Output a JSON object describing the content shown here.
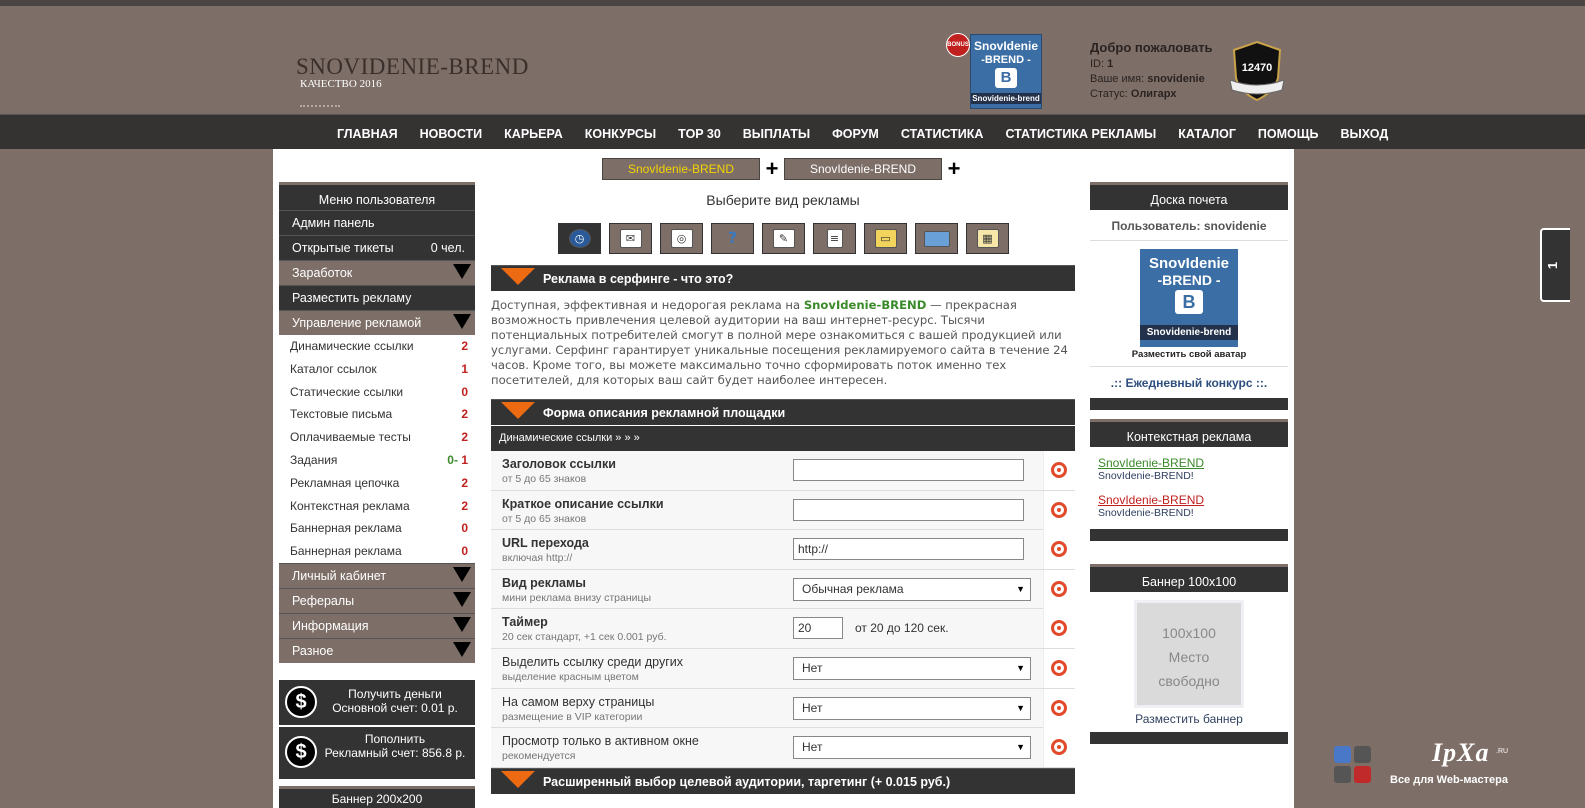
{
  "header": {
    "site_title": "SNOVIDENIE-BREND",
    "site_sub": "КАЧЕСТВО 2016",
    "bonus": "BONUS",
    "logo_l1": "SnovIdenie",
    "logo_l2": "-BREND -",
    "logo_b": "B",
    "logo_l3": "Snovidenie-brend",
    "welcome": "Добро пожаловать",
    "id_label": "ID:",
    "id_value": "1",
    "name_label": "Ваше имя:",
    "name_value": "snovidenie",
    "status_label": "Статус:",
    "status_value": "Олигарх",
    "badge_number": "12470"
  },
  "nav": [
    "ГЛАВНАЯ",
    "НОВОСТИ",
    "КАРЬЕРА",
    "КОНКУРСЫ",
    "TOP 30",
    "ВЫПЛАТЫ",
    "ФОРУМ",
    "СТАТИСТИКА",
    "СТАТИСТИКА РЕКЛАМЫ",
    "КАТАЛОГ",
    "ПОМОЩЬ",
    "ВЫХОД"
  ],
  "tabs": [
    "SnovIdenie-BREND",
    "SnovIdenie-BREND"
  ],
  "left": {
    "title": "Меню пользователя",
    "admin": "Админ панель",
    "tickets": "Открытые тикеты",
    "tickets_count": "0 чел.",
    "earnings": "Заработок",
    "place_ad": "Разместить рекламу",
    "manage": "Управление рекламой",
    "items": [
      {
        "label": "Динамические ссылки",
        "count": "2"
      },
      {
        "label": "Каталог ссылок",
        "count": "1"
      },
      {
        "label": "Статические ссылки",
        "count": "0"
      },
      {
        "label": "Текстовые письма",
        "count": "2"
      },
      {
        "label": "Оплачиваемые тесты",
        "count": "2"
      },
      {
        "label": "Задания",
        "count_green": "0",
        "count_sep": "-",
        "count": "1"
      },
      {
        "label": "Рекламная цепочка",
        "count": "2"
      },
      {
        "label": "Контекстная реклама",
        "count": "2"
      },
      {
        "label": "Баннерная реклама",
        "count": "0"
      },
      {
        "label": "Баннерная реклама",
        "count": "0"
      }
    ],
    "cabinet": "Личный кабинет",
    "referrals": "Рефералы",
    "info": "Информация",
    "misc": "Разное",
    "money1_l1": "Получить деньги",
    "money1_l2": "Основной счет: 0.01 р.",
    "money2_l1": "Пополнить",
    "money2_l2": "Рекламный счет: 856.8 р.",
    "money_icon": "$",
    "banner_title": "Баннер 200x200"
  },
  "center": {
    "choose": "Выберите вид рекламы",
    "surf_title": "Реклама в серфинге - что это?",
    "desc_pre": "Доступная, эффективная и недорогая реклама на ",
    "desc_brand": "SnovIdenie-BREND",
    "desc_post": " — прекрасная возможность привлечения целевой аудитории на ваш интернет-ресурс. Тысячи потенциальных потребителей смогут в полной мере ознакомиться с вашей продукцией или услугами. Серфинг гарантирует уникальные посещения рекламируемого сайта в течение 24 часов. Кроме того, вы можете максимально точно сформировать поток именно тех посетителей, для которых ваш сайт будет наиболее интересен.",
    "form_title": "Форма описания рекламной площадки",
    "subhead": "Динамические ссылки » » »",
    "rows": [
      {
        "label": "Заголовок ссылки",
        "sub": "от 5 до 65 знаков",
        "value": ""
      },
      {
        "label": "Краткое описание ссылки",
        "sub": "от 5 до 65 знаков",
        "value": ""
      },
      {
        "label": "URL перехода",
        "sub": "включая http://",
        "value": "http://"
      },
      {
        "label": "Вид рекламы",
        "sub": "мини реклама внизу страницы",
        "value": "Обычная реклама"
      },
      {
        "label": "Таймер",
        "sub": "20 сек стандарт, +1 сек 0.001 руб.",
        "value": "20",
        "hint": "от 20 до 120 сек."
      },
      {
        "label": "Выделить ссылку среди других",
        "sub": "выделение красным цветом",
        "value": "Нет"
      },
      {
        "label": "На самом верху страницы",
        "sub": "размещение в VIP категории",
        "value": "Нет"
      },
      {
        "label": "Просмотр только в активном окне",
        "sub": "рекомендуется",
        "value": "Нет"
      }
    ],
    "target_title": "Расширенный выбор целевой аудитории, таргетинг (+ 0.015 руб.)"
  },
  "right": {
    "honor_title": "Доска почета",
    "user_label": "Пользователь: snovidenie",
    "avatar_l1": "SnovIdenie",
    "avatar_l2": "-BREND -",
    "avatar_b": "B",
    "avatar_l3": "Snovidenie-brend",
    "avatar_cap": "Разместить свой аватар",
    "contest": ".:: Ежедневный конкурс ::.",
    "ctx_title": "Контекстная реклама",
    "ctx1_link": "SnovIdenie-BREND",
    "ctx1_desc": "SnovIdenie-BREND!",
    "ctx2_link": "SnovIdenie-BREND",
    "ctx2_desc": "SnovIdenie-BREND!",
    "banner_title": "Баннер 100x100",
    "banner_l1": "100x100",
    "banner_l2": "Место",
    "banner_l3": "свободно",
    "banner_cap": "Разместить баннер"
  },
  "side_tab": "1",
  "watermark": {
    "brand": "IpXa",
    "tld": ".RU",
    "tagline": "Все для Web-мастера"
  },
  "colors": {
    "bg": "#7d6e67",
    "dark": "#333333",
    "accent_orange": "#ec6b12",
    "red": "#c0201e",
    "green": "#3a8a2a",
    "yellow_tab": "#f5d400"
  }
}
